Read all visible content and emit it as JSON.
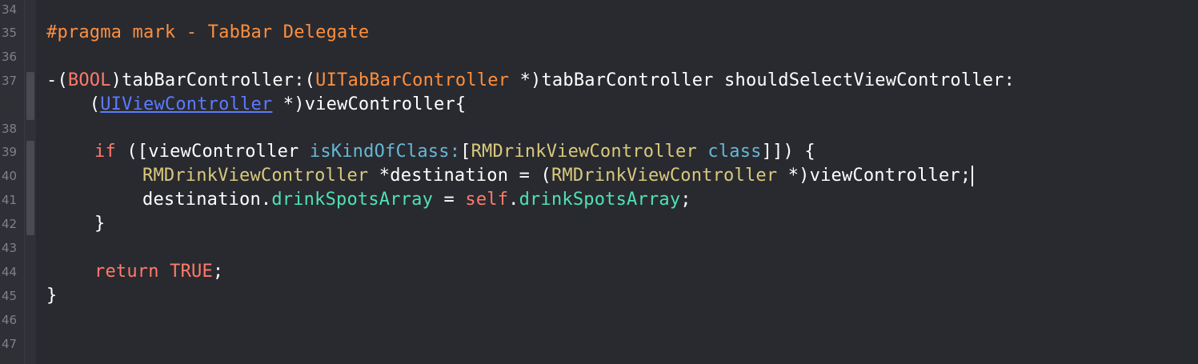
{
  "colors": {
    "background": "#292a30",
    "gutter": "#2f3036",
    "line_number": "#7f8089",
    "preprocessor": "#fd8f3f",
    "keyword": "#ff7a6a",
    "type_name": "#d9c97c",
    "method": "#67b7d4",
    "property": "#4fe3b0",
    "link": "#5b7bff",
    "plain": "#ffffff"
  },
  "line_numbers": [
    "34",
    "35",
    "36",
    "37",
    "38",
    "39",
    "40",
    "41",
    "42",
    "43",
    "44",
    "45",
    "46",
    "47"
  ],
  "code": {
    "l35_pragma": "#pragma mark - TabBar Delegate",
    "l37_open": "-(",
    "l37_bool": "BOOL",
    "l37_a": ")tabBarController:(",
    "l37_cls": "UITabBarController",
    "l37_b": " *)tabBarController shouldSelectViewController:",
    "l37w_open": "    (",
    "l37w_link": "UIViewController",
    "l37w_b": " *)viewController{",
    "l39_if": "if",
    "l39_a": " ([viewController ",
    "l39_method": "isKindOfClass:",
    "l39_b": "[",
    "l39_cls": "RMDrinkViewController",
    "l39_class": " class",
    "l39_c": "]]) {",
    "l40_cls1": "RMDrinkViewController",
    "l40_a": " *destination = (",
    "l40_cls2": "RMDrinkViewController",
    "l40_b": " *)viewController;",
    "l41_a": "destination.",
    "l41_prop1": "drinkSpotsArray",
    "l41_b": " = ",
    "l41_self": "self",
    "l41_c": ".",
    "l41_prop2": "drinkSpotsArray",
    "l41_d": ";",
    "l42_close": "}",
    "l44_return": "return",
    "l44_sp": " ",
    "l44_true": "TRUE",
    "l44_semi": ";",
    "l45_close": "}"
  }
}
